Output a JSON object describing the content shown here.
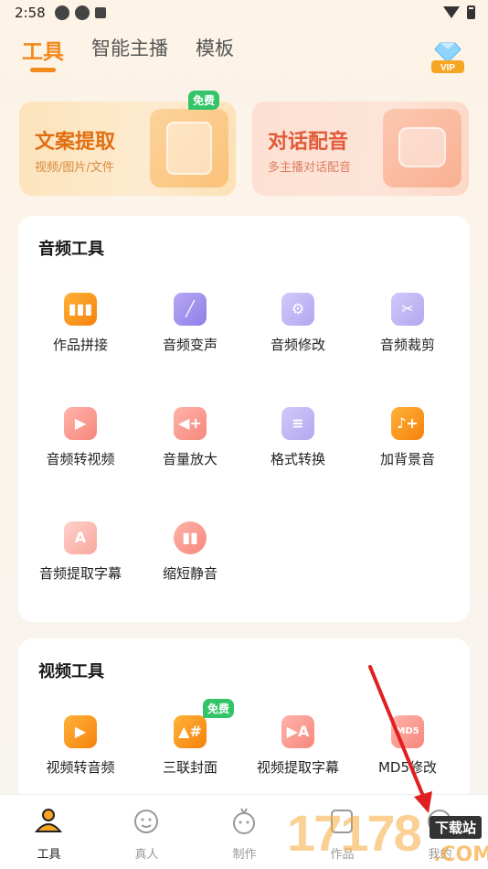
{
  "status_bar": {
    "time": "2:58"
  },
  "top_tabs": [
    {
      "label": "工具",
      "active": true
    },
    {
      "label": "智能主播",
      "active": false
    },
    {
      "label": "模板",
      "active": false
    }
  ],
  "vip": {
    "label": "VIP"
  },
  "cards": [
    {
      "title": "文案提取",
      "subtitle": "视频/图片/文件",
      "badge": "免费"
    },
    {
      "title": "对话配音",
      "subtitle": "多主播对话配音"
    }
  ],
  "audio_tools": {
    "title": "音频工具",
    "items": [
      {
        "label": "作品拼接",
        "icon": "waveform-icon"
      },
      {
        "label": "音频变声",
        "icon": "magic-wand-icon"
      },
      {
        "label": "音频修改",
        "icon": "file-gear-icon"
      },
      {
        "label": "音频裁剪",
        "icon": "file-scissors-icon"
      },
      {
        "label": "音频转视频",
        "icon": "file-video-icon"
      },
      {
        "label": "音量放大",
        "icon": "speaker-plus-icon"
      },
      {
        "label": "格式转换",
        "icon": "file-convert-icon"
      },
      {
        "label": "加背景音",
        "icon": "music-note-plus-icon"
      },
      {
        "label": "音频提取字幕",
        "icon": "file-subtitle-icon"
      },
      {
        "label": "缩短静音",
        "icon": "stopwatch-icon"
      }
    ]
  },
  "video_tools": {
    "title": "视频工具",
    "items": [
      {
        "label": "视频转音频",
        "icon": "video-audio-icon"
      },
      {
        "label": "三联封面",
        "icon": "image-grid-icon",
        "badge": "免费"
      },
      {
        "label": "视频提取字幕",
        "icon": "video-subtitle-icon"
      },
      {
        "label": "MD5修改",
        "icon": "md5-icon"
      }
    ]
  },
  "bottom_nav": [
    {
      "label": "工具",
      "active": true
    },
    {
      "label": "真人",
      "active": false
    },
    {
      "label": "制作",
      "active": false
    },
    {
      "label": "作品",
      "active": false
    },
    {
      "label": "我的",
      "active": false
    }
  ],
  "watermark": {
    "digits": "17178",
    "badge": "下载站",
    "suffix": ".COM"
  },
  "colors": {
    "accent": "#f28a1d",
    "free_badge": "#33c46a",
    "audio_icon_orange": "#f5820b",
    "icon_purple": "#8f7ee8",
    "icon_pink": "#f6877c"
  }
}
